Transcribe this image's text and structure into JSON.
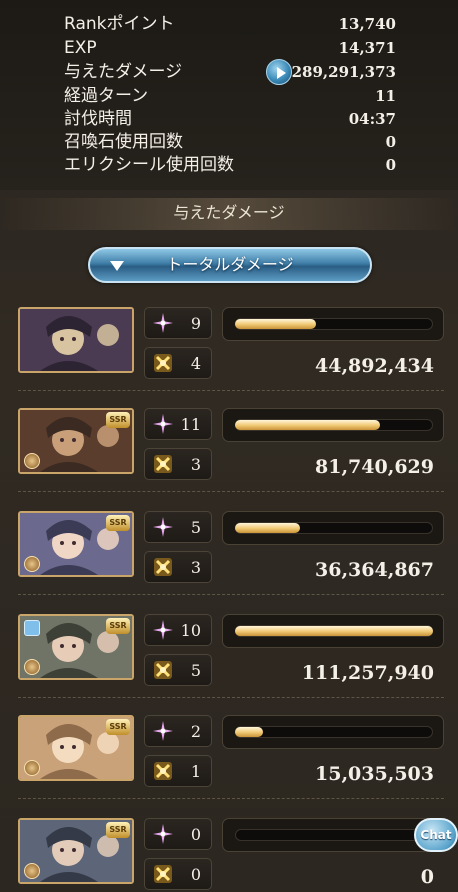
{
  "results": [
    {
      "label": "Rankポイント",
      "value": "13,740"
    },
    {
      "label": "EXP",
      "value": "14,371"
    },
    {
      "label": "与えたダメージ",
      "value": "289,291,373"
    },
    {
      "label": "経過ターン",
      "value": "11"
    },
    {
      "label": "討伐時間",
      "value": "04:37"
    },
    {
      "label": "召喚石使用回数",
      "value": "0"
    },
    {
      "label": "エリクシール使用回数",
      "value": "0"
    }
  ],
  "section_title": "与えたダメージ",
  "dropdown": {
    "selected": "トータルダメージ"
  },
  "members": [
    {
      "rarity": "",
      "skills": "9",
      "ougi": "4",
      "damage": "44,892,434",
      "bar_fraction": 0.41
    },
    {
      "rarity": "SSR",
      "skills": "11",
      "ougi": "3",
      "damage": "81,740,629",
      "bar_fraction": 0.73
    },
    {
      "rarity": "SSR",
      "skills": "5",
      "ougi": "3",
      "damage": "36,364,867",
      "bar_fraction": 0.33
    },
    {
      "rarity": "SSR",
      "skills": "10",
      "ougi": "5",
      "damage": "111,257,940",
      "bar_fraction": 1.0
    },
    {
      "rarity": "SSR",
      "skills": "2",
      "ougi": "1",
      "damage": "15,035,503",
      "bar_fraction": 0.14
    },
    {
      "rarity": "SSR",
      "skills": "0",
      "ougi": "0",
      "damage": "0",
      "bar_fraction": 0.0
    }
  ],
  "chat_button": "Chat",
  "colors": {
    "bar_fill": "#f0c873",
    "accent_blue": "#3f7ea8",
    "panel": "#2e2922"
  }
}
